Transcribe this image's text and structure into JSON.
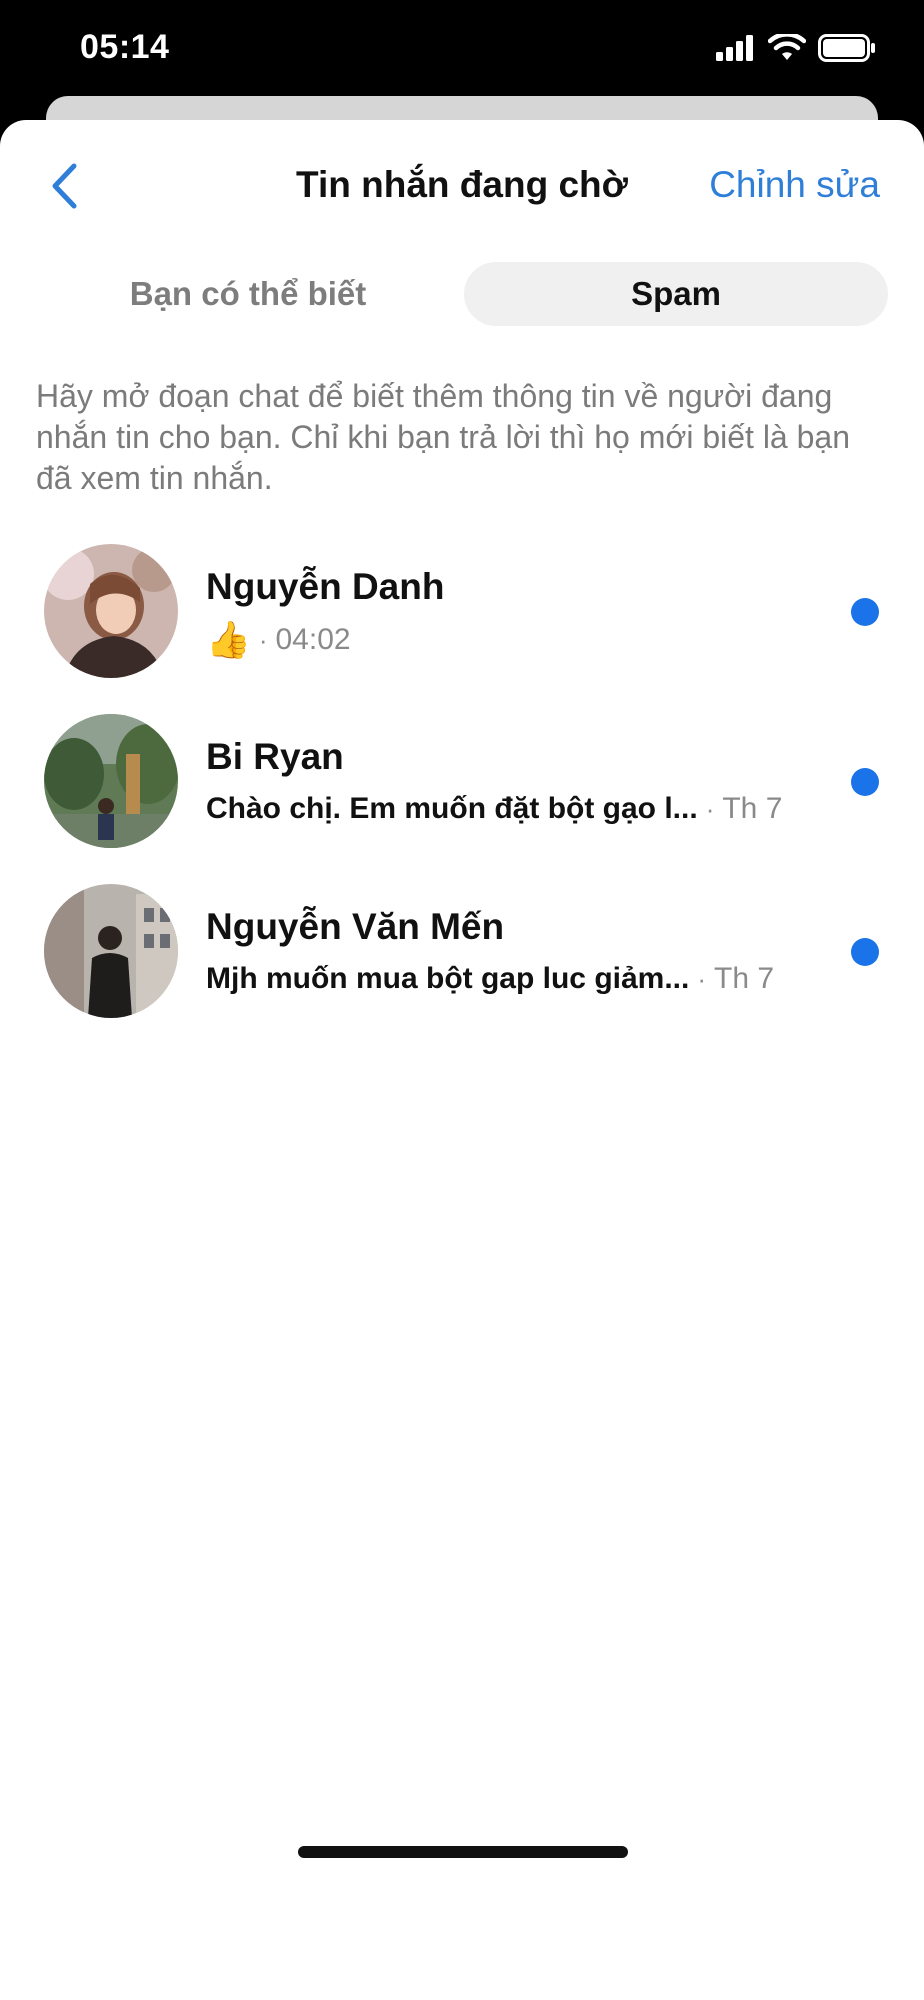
{
  "status_bar": {
    "time": "05:14",
    "icons": [
      "signal-icon",
      "wifi-icon",
      "battery-icon"
    ]
  },
  "nav": {
    "title": "Tin nhắn đang chờ",
    "edit_label": "Chỉnh sửa",
    "back_icon": "chevron-left-icon"
  },
  "tabs": [
    {
      "label": "Bạn có thể biết",
      "selected": false
    },
    {
      "label": "Spam",
      "selected": true
    }
  ],
  "info_text": "Hãy mở đoạn chat để biết thêm thông tin về người đang nhắn tin cho bạn. Chỉ khi bạn trả lời thì họ mới biết là bạn đã xem tin nhắn.",
  "conversations": [
    {
      "name": "Nguyễn Danh",
      "preview": "👍",
      "separator": "·",
      "time": "04:02",
      "unread": true
    },
    {
      "name": "Bi Ryan",
      "preview": "Chào chị. Em muốn đặt bột gạo l...",
      "separator": "·",
      "time": "Th 7",
      "unread": true
    },
    {
      "name": "Nguyễn Văn Mến",
      "preview": "Mjh muốn mua bột gap luc giảm...",
      "separator": "·",
      "time": "Th 7",
      "unread": true
    }
  ],
  "colors": {
    "accent": "#2f7fd8",
    "unread_dot": "#1a73e8",
    "secondary_text": "#7b7b7b"
  }
}
